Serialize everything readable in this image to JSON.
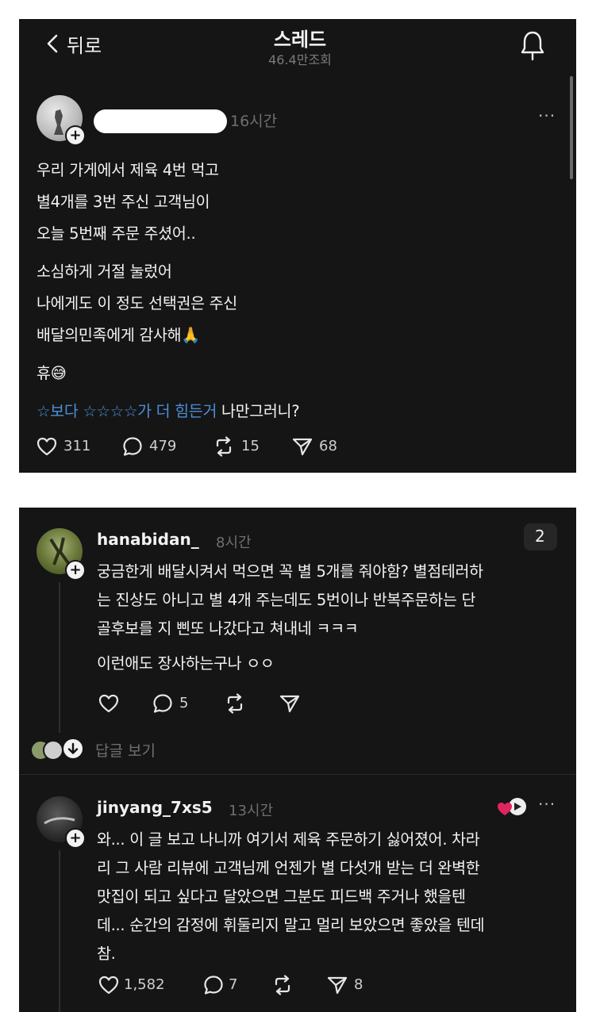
{
  "header": {
    "back_label": "뒤로",
    "title": "스레드",
    "views": "46.4만조회"
  },
  "post": {
    "time": "16시간",
    "more": "···",
    "lines": [
      "우리 가게에서 제육 4번 먹고",
      "별4개를 3번 주신 고객님이",
      "오늘 5번째 주문 주셨어..",
      "소심하게 거절 눌렀어",
      "나에게도 이 정도 선택권은 주신",
      "배달의민족에게 감사해",
      "휴"
    ],
    "emoji_pray": "🙏",
    "emoji_face": "😅",
    "tag_line": {
      "linked": "☆보다 ☆☆☆☆가 더  힘든거",
      "plain": " 나만그러니?"
    },
    "likes": "311",
    "comments": "479",
    "reposts": "15",
    "shares": "68"
  },
  "reply1": {
    "username": "hanabidan_",
    "time": "8시간",
    "badge": "2",
    "lines": [
      "궁금한게 배달시켜서 먹으면 꼭 별 5개를 줘야함? 별점테러하",
      "는 진상도 아니고 별 4개 주는데도 5번이나 반복주문하는 단",
      "골후보를 지 삔또 나갔다고 쳐내네 ㅋㅋㅋ",
      "이런애도 장사하는구나 ㅇㅇ"
    ],
    "comments": "5",
    "view_replies": "답글 보기"
  },
  "reply2": {
    "username": "jinyang_7xs5",
    "time": "13시간",
    "more": "···",
    "lines": [
      "와... 이 글 보고 나니까 여기서 제육 주문하기 싫어졌어. 차라",
      "리 그 사람 리뷰에 고객님께 언젠가 별 다섯개 받는 더 완벽한",
      "맛집이 되고 싶다고 달았으면 그분도 피드백 주거나 했을텐",
      "데... 순간의 감정에 휘둘리지 말고 멀리 보았으면 좋았을 텐데",
      "참."
    ],
    "likes": "1,582",
    "comments": "7",
    "shares": "8"
  }
}
